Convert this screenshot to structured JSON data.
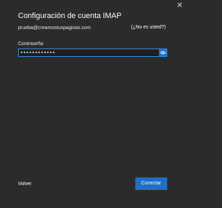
{
  "window": {
    "close_label": "✕"
  },
  "header": {
    "title": "Configuración de cuenta IMAP",
    "email": "prueba@creamostuspaginas.com",
    "not_you_link": "(¿No es usted?)"
  },
  "form": {
    "password_label": "Contraseña",
    "password_value": "••••••••••••",
    "reveal_icon": "eye-icon"
  },
  "footer": {
    "back_label": "Volver",
    "connect_label": "Conectar"
  },
  "colors": {
    "background": "#2b2b2b",
    "accent": "#1f6fc6",
    "input_border": "#3a8ee6"
  }
}
